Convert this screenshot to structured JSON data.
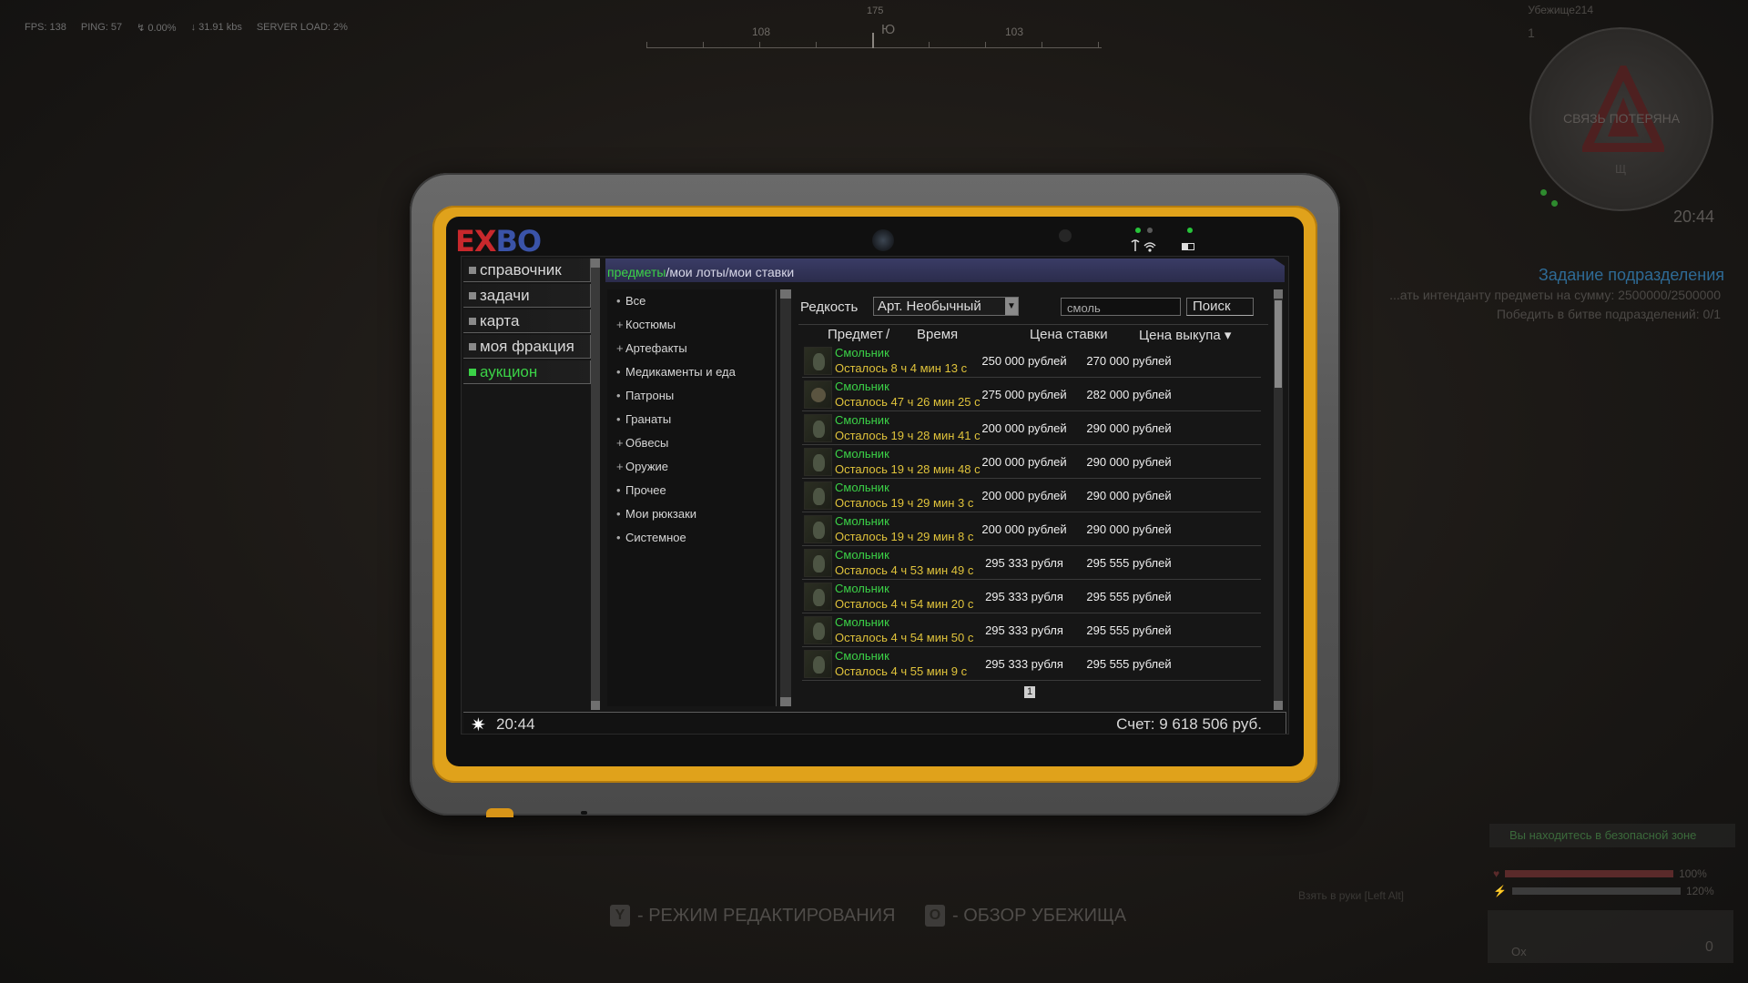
{
  "hud": {
    "fps": "FPS: 138",
    "ping": "PING: 57",
    "loss": "↯ 0.00%",
    "traffic": "↓ 31.91 kbs",
    "server_load": "SERVER LOAD: 2%",
    "compass": {
      "heading_num": "175",
      "left": "108",
      "center": "Ю",
      "right": "103"
    },
    "minimap_title": "Убежище214",
    "minimap_level": "1",
    "connection_lost": "СВЯЗЬ ПОТЕРЯНА",
    "minimap_mark": "Щ",
    "time": "20:44",
    "quest": {
      "title": "Задание подразделения",
      "line1": "...ать интенданту предметы на сумму: 2500000/2500000",
      "line2": "Победить в битве подразделений: 0/1"
    },
    "hints": [
      {
        "key": "Y",
        "label": "- РЕЖИМ РЕДАКТИРОВАНИЯ"
      },
      {
        "key": "O",
        "label": "- ОБЗОР УБЕЖИЩА"
      }
    ],
    "safe_zone": "Вы находитесь в безопасной зоне",
    "health_pct": "100%",
    "stamina_pct": "120%",
    "pickup_hint": "Взять в руки [Left Alt]",
    "inv_ox": "Ox",
    "inv_zero": "0"
  },
  "tablet": {
    "logo_red": "EX",
    "logo_blue": "BO",
    "nav": [
      {
        "label": "справочник",
        "active": false
      },
      {
        "label": "задачи",
        "active": false
      },
      {
        "label": "карта",
        "active": false
      },
      {
        "label": "моя фракция",
        "active": false
      },
      {
        "label": "аукцион",
        "active": true
      }
    ],
    "breadcrumb": {
      "items": "предметы",
      "lots": "мои лоты",
      "bids": "мои ставки",
      "sep": "/"
    },
    "categories": [
      {
        "mark": "•",
        "label": "Все"
      },
      {
        "mark": "+",
        "label": "Костюмы"
      },
      {
        "mark": "+",
        "label": "Артефакты"
      },
      {
        "mark": "•",
        "label": "Медикаменты и еда"
      },
      {
        "mark": "•",
        "label": "Патроны"
      },
      {
        "mark": "•",
        "label": "Гранаты"
      },
      {
        "mark": "+",
        "label": "Обвесы"
      },
      {
        "mark": "+",
        "label": "Оружие"
      },
      {
        "mark": "•",
        "label": "Прочее"
      },
      {
        "mark": "•",
        "label": "Мои рюкзаки"
      },
      {
        "mark": "•",
        "label": "Системное"
      }
    ],
    "filter": {
      "rarity_label": "Редкость",
      "rarity_value": "Арт. Необычный",
      "search_value": "смоль",
      "search_button": "Поиск"
    },
    "table": {
      "headers": {
        "item": "Предмет",
        "sep": "/",
        "time": "Время",
        "bid": "Цена ставки",
        "buyout": "Цена выкупа ▾"
      },
      "rows": [
        {
          "name": "Смольник",
          "time": "Осталось 8 ч 4 мин 13 с",
          "bid": "250 000 рублей",
          "buyout": "270 000 рублей"
        },
        {
          "name": "Смольник",
          "time": "Осталось 47 ч 26 мин 25 с",
          "bid": "275 000 рублей",
          "buyout": "282 000 рублей"
        },
        {
          "name": "Смольник",
          "time": "Осталось 19 ч 28 мин 41 с",
          "bid": "200 000 рублей",
          "buyout": "290 000 рублей"
        },
        {
          "name": "Смольник",
          "time": "Осталось 19 ч 28 мин 48 с",
          "bid": "200 000 рублей",
          "buyout": "290 000 рублей"
        },
        {
          "name": "Смольник",
          "time": "Осталось 19 ч 29 мин 3 с",
          "bid": "200 000 рублей",
          "buyout": "290 000 рублей"
        },
        {
          "name": "Смольник",
          "time": "Осталось 19 ч 29 мин 8 с",
          "bid": "200 000 рублей",
          "buyout": "290 000 рублей"
        },
        {
          "name": "Смольник",
          "time": "Осталось 4 ч 53 мин 49 с",
          "bid": "295 333 рубля",
          "buyout": "295 555 рублей"
        },
        {
          "name": "Смольник",
          "time": "Осталось 4 ч 54 мин 20 с",
          "bid": "295 333 рубля",
          "buyout": "295 555 рублей"
        },
        {
          "name": "Смольник",
          "time": "Осталось 4 ч 54 мин 50 с",
          "bid": "295 333 рубля",
          "buyout": "295 555 рублей"
        },
        {
          "name": "Смольник",
          "time": "Осталось 4 ч 55 мин 9 с",
          "bid": "295 333 рубля",
          "buyout": "295 555 рублей"
        }
      ],
      "page": "1"
    },
    "status": {
      "sun": "✷",
      "time": "20:44",
      "account": "Счет: 9 618 506 руб."
    }
  }
}
